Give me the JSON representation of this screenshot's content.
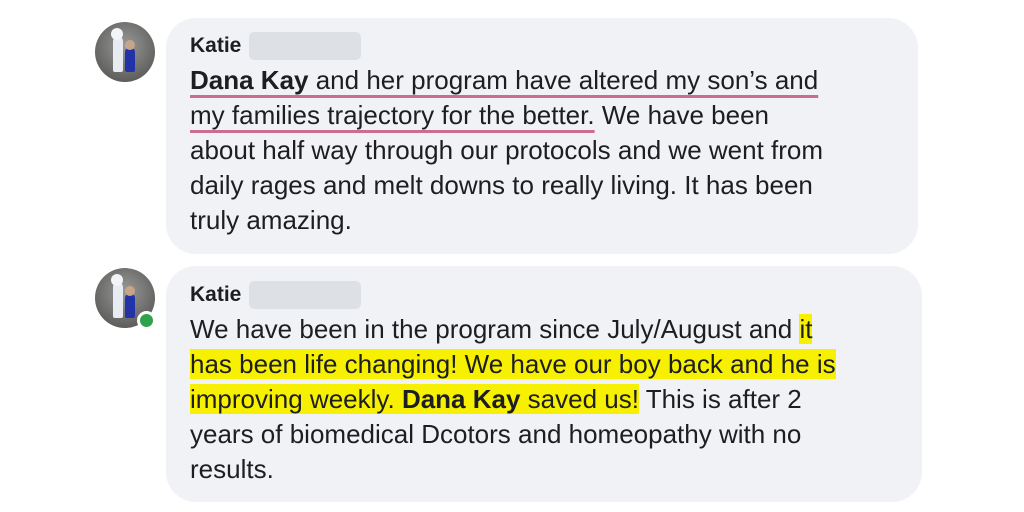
{
  "comments": [
    {
      "author": "Katie",
      "online": false,
      "lines": [
        [
          "Dana Kay",
          " and her program have altered my son’s and"
        ],
        [
          "my families trajectory for the better.",
          " We have been"
        ],
        [
          "about half way through our protocols and we went from"
        ],
        [
          "daily rages and melt downs to really living. It has been"
        ],
        [
          "truly amazing."
        ]
      ]
    },
    {
      "author": "Katie",
      "online": true,
      "lines": [
        [
          "We have been in the program since July/August and ",
          "it"
        ],
        [
          "has been life changing! We have our boy back and he is"
        ],
        [
          "improving weekly. ",
          "Dana Kay",
          " saved us!",
          " This is after 2"
        ],
        [
          "years of biomedical Dcotors and homeopathy with no"
        ],
        [
          "results."
        ]
      ]
    }
  ],
  "colors": {
    "bubble": "#f0f2f5",
    "highlight": "#f7f000",
    "underline": "#cc6d8e",
    "online": "#31a24c"
  }
}
